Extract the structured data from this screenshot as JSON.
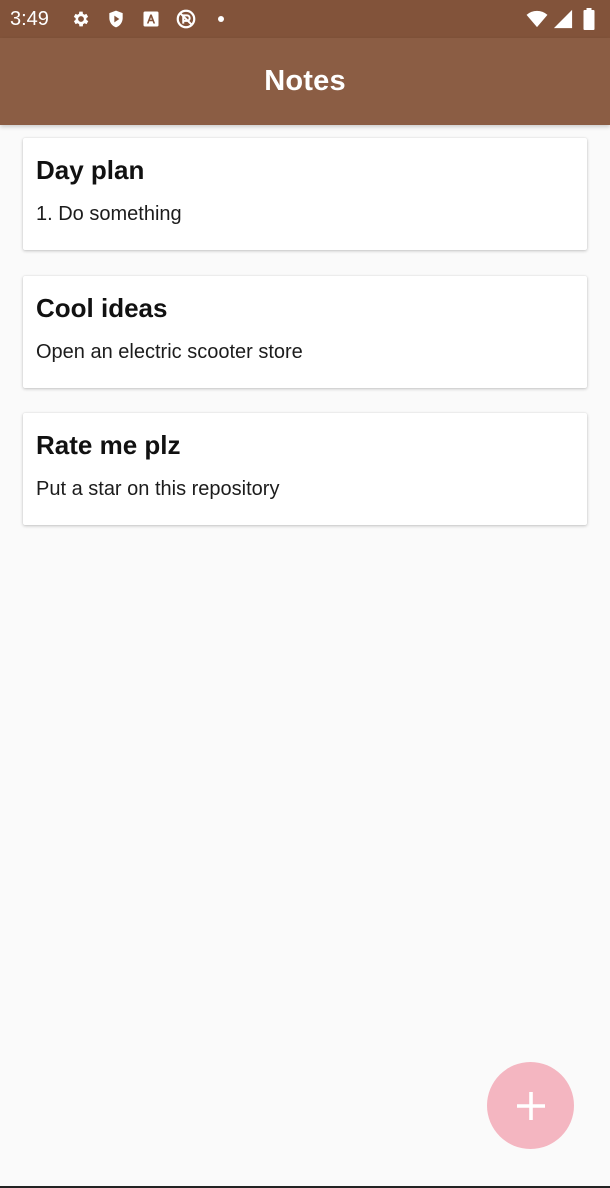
{
  "status_bar": {
    "time": "3:49",
    "left_icons": [
      "settings-icon",
      "shield-play-icon",
      "font-a-icon",
      "no-tracking-icon",
      "dot-icon"
    ],
    "right_icons": [
      "wifi-icon",
      "cellular-signal-icon",
      "battery-icon"
    ],
    "background": "#82533a"
  },
  "app_bar": {
    "title": "Notes",
    "background": "#8b5d44"
  },
  "notes": [
    {
      "title": "Day plan",
      "body": "1. Do something"
    },
    {
      "title": "Cool ideas",
      "body": "Open an electric scooter store"
    },
    {
      "title": "Rate me plz",
      "body": "Put a star on this repository"
    }
  ],
  "fab": {
    "icon": "plus-icon",
    "color": "#f4b6c1"
  }
}
